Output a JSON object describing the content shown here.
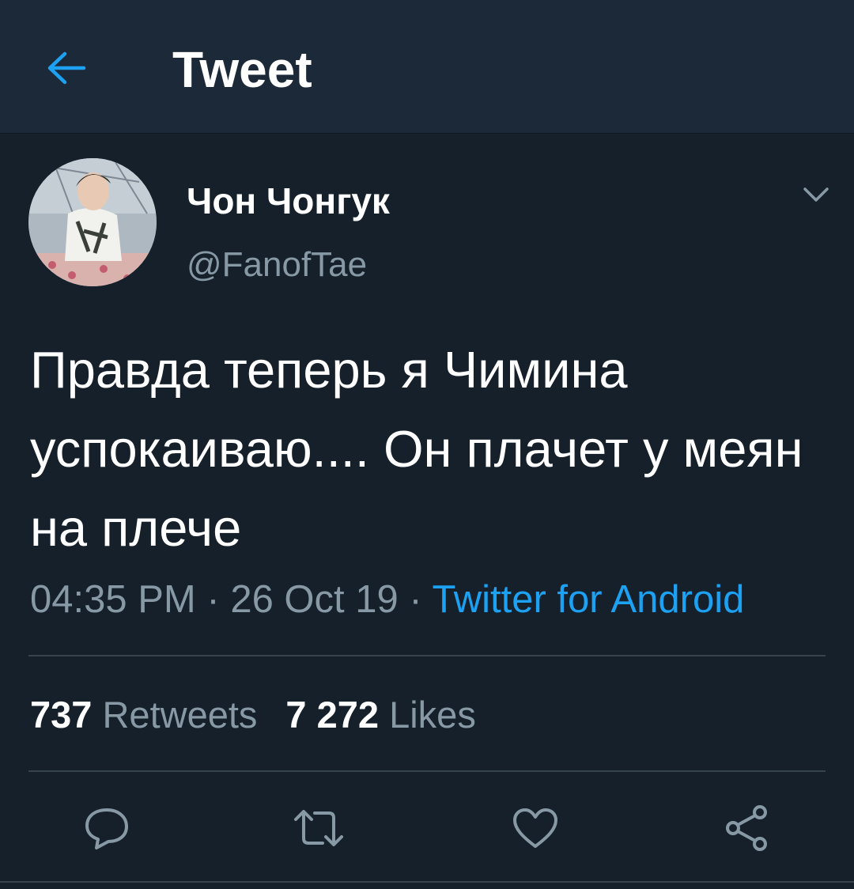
{
  "header": {
    "title": "Tweet",
    "back_icon": "arrow-left-icon",
    "accent_color": "#1da1f2",
    "background": "#1c2938"
  },
  "tweet": {
    "author": {
      "name": "Чон Чонгук",
      "handle": "@FanofTae"
    },
    "text": "Правда теперь я Чимина успокаиваю.... Он плачет у меян на плече",
    "time": "04:35 PM",
    "date": "26 Oct 19",
    "separator": "·",
    "source": "Twitter for Android",
    "stats": {
      "retweets_count": "737",
      "retweets_label": "Retweets",
      "likes_count": "7 272",
      "likes_label": "Likes"
    }
  },
  "actions": [
    {
      "name": "reply",
      "icon": "speech-bubble-icon"
    },
    {
      "name": "retweet",
      "icon": "retweet-icon"
    },
    {
      "name": "like",
      "icon": "heart-icon"
    },
    {
      "name": "share",
      "icon": "share-icon"
    }
  ],
  "colors": {
    "background": "#15202b",
    "secondary_text": "#8899a6",
    "divider": "#38444d",
    "link": "#1da1f2"
  }
}
